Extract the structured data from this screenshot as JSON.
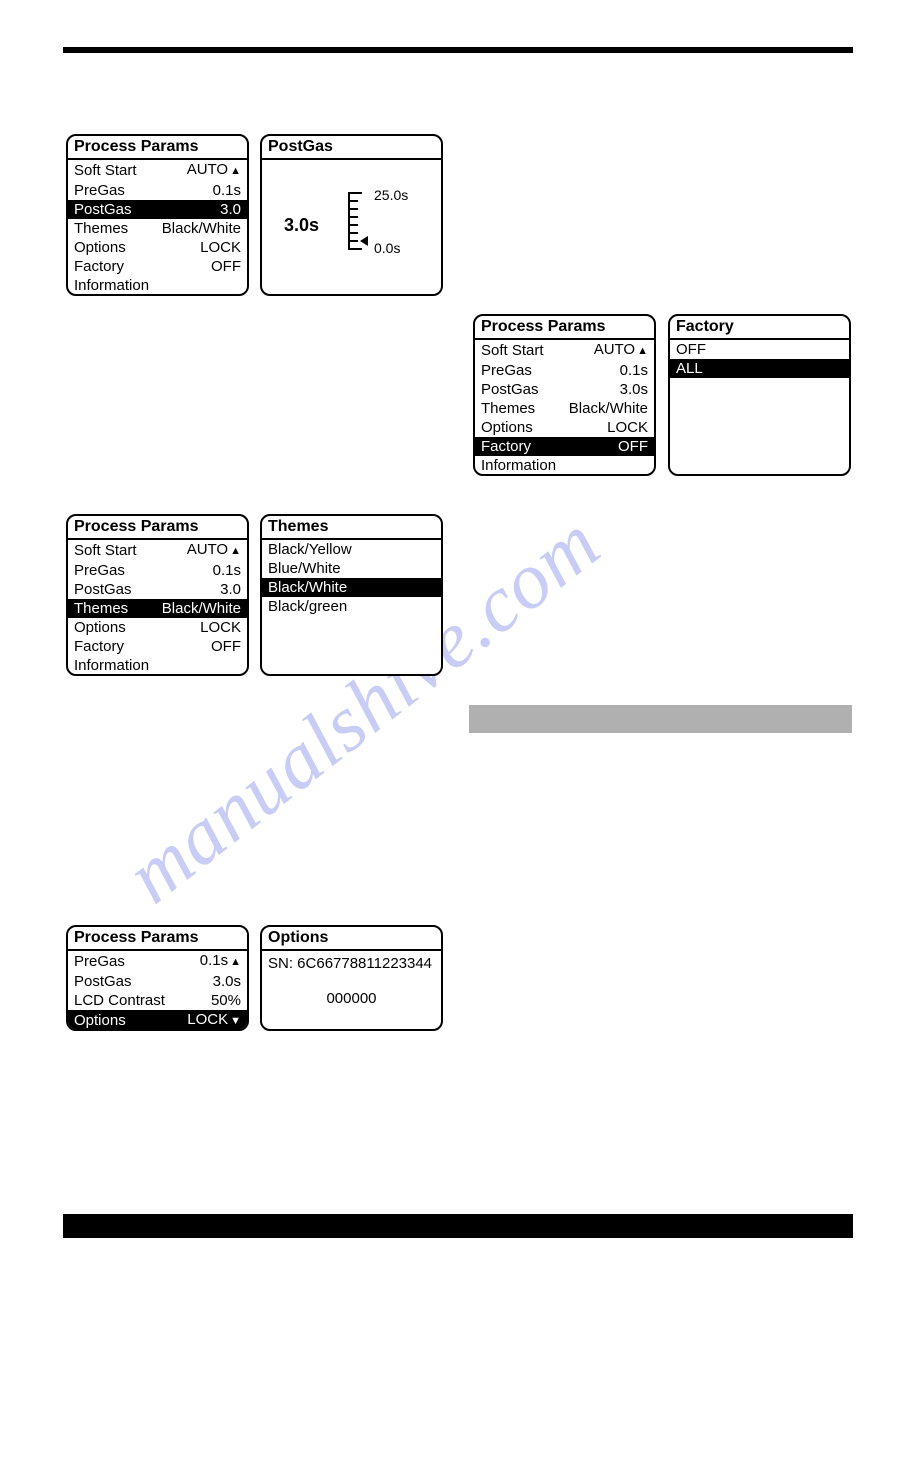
{
  "watermark": "manualshive.com",
  "panel1": {
    "title": "Process Params",
    "items": [
      {
        "label": "Soft Start",
        "value": "AUTO",
        "arrow_up": true
      },
      {
        "label": "PreGas",
        "value": "0.1s"
      },
      {
        "label": "PostGas",
        "value": "3.0",
        "selected": true
      },
      {
        "label": "Themes",
        "value": "Black/White"
      },
      {
        "label": "Options",
        "value": "LOCK"
      },
      {
        "label": "Factory",
        "value": "OFF"
      },
      {
        "label": "Information",
        "value": ""
      }
    ]
  },
  "postgas_panel": {
    "title": "PostGas",
    "value": "3.0s",
    "max": "25.0s",
    "min": "0.0s"
  },
  "panel2": {
    "title": "Process Params",
    "items": [
      {
        "label": "Soft Start",
        "value": "AUTO",
        "arrow_up": true
      },
      {
        "label": "PreGas",
        "value": "0.1s"
      },
      {
        "label": "PostGas",
        "value": "3.0s"
      },
      {
        "label": "Themes",
        "value": "Black/White"
      },
      {
        "label": "Options",
        "value": "LOCK"
      },
      {
        "label": "Factory",
        "value": "OFF",
        "selected": true
      },
      {
        "label": "Information",
        "value": ""
      }
    ]
  },
  "factory_panel": {
    "title": "Factory",
    "items": [
      {
        "label": "OFF"
      },
      {
        "label": "ALL",
        "selected": true
      }
    ]
  },
  "panel3": {
    "title": "Process Params",
    "items": [
      {
        "label": "Soft Start",
        "value": "AUTO",
        "arrow_up": true
      },
      {
        "label": "PreGas",
        "value": "0.1s"
      },
      {
        "label": "PostGas",
        "value": "3.0"
      },
      {
        "label": "Themes",
        "value": "Black/White",
        "selected": true
      },
      {
        "label": "Options",
        "value": "LOCK"
      },
      {
        "label": "Factory",
        "value": "OFF"
      },
      {
        "label": "Information",
        "value": ""
      }
    ]
  },
  "themes_panel": {
    "title": "Themes",
    "items": [
      {
        "label": "Black/Yellow"
      },
      {
        "label": "Blue/White"
      },
      {
        "label": "Black/White",
        "selected": true
      },
      {
        "label": "Black/green"
      }
    ]
  },
  "panel4": {
    "title": "Process Params",
    "items": [
      {
        "label": "PreGas",
        "value": "0.1s",
        "arrow_up": true
      },
      {
        "label": "PostGas",
        "value": "3.0s"
      },
      {
        "label": "LCD Contrast",
        "value": "50%"
      },
      {
        "label": "Options",
        "value": "LOCK",
        "selected": true,
        "arrow_down": true
      }
    ]
  },
  "options_panel": {
    "title": "Options",
    "sn": "SN: 6C66778811223344",
    "code": "000000"
  }
}
